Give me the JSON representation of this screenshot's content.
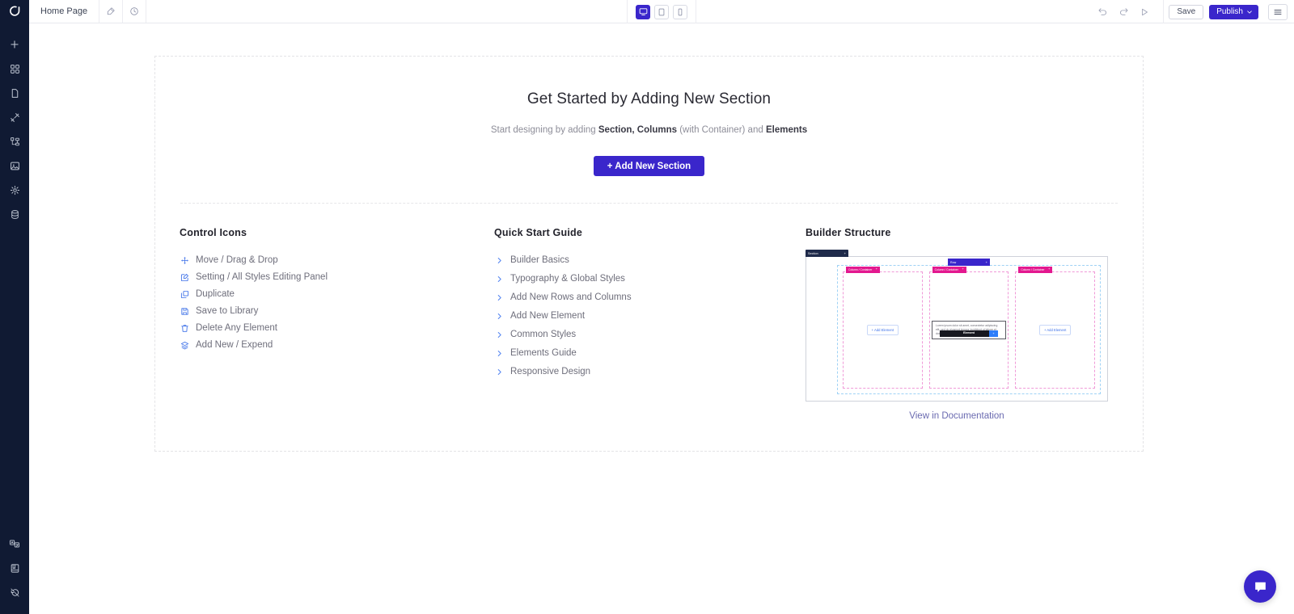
{
  "app": {
    "logo_icon": "droip-logo-icon",
    "accent": "#3A26CB",
    "rail_bg": "#101A33"
  },
  "topbar": {
    "page_name": "Home Page",
    "pen_icon": "pen-tool-icon",
    "history_icon": "clock-history-icon",
    "devices": [
      {
        "name": "desktop",
        "icon": "desktop-icon",
        "active": true
      },
      {
        "name": "tablet",
        "icon": "tablet-icon",
        "active": false
      },
      {
        "name": "mobile",
        "icon": "mobile-icon",
        "active": false
      }
    ],
    "undo_icon": "undo-icon",
    "redo_icon": "redo-icon",
    "preview_icon": "play-preview-icon",
    "save_label": "Save",
    "publish_label": "Publish",
    "publish_caret": "⌄",
    "menu_icon": "hamburger-menu-icon"
  },
  "sidebar": {
    "items": [
      {
        "name": "add",
        "icon": "plus-icon"
      },
      {
        "name": "elements",
        "icon": "grid-widgets-icon"
      },
      {
        "name": "pages",
        "icon": "page-document-icon"
      },
      {
        "name": "styles",
        "icon": "paint-brush-icon"
      },
      {
        "name": "layers",
        "icon": "layers-tree-icon"
      },
      {
        "name": "media",
        "icon": "image-icon"
      },
      {
        "name": "settings",
        "icon": "gear-icon"
      },
      {
        "name": "data",
        "icon": "database-icon"
      }
    ],
    "bottom_items": [
      {
        "name": "translate",
        "icon": "translate-icon"
      },
      {
        "name": "docs",
        "icon": "book-icon"
      },
      {
        "name": "shortcuts",
        "icon": "history-revert-icon"
      }
    ]
  },
  "onboarding": {
    "title": "Get Started by Adding New Section",
    "subtitle_parts": [
      {
        "text": "Start designing by adding ",
        "bold": false
      },
      {
        "text": "Section, Columns",
        "bold": true
      },
      {
        "text": " (with Container) and ",
        "bold": false
      },
      {
        "text": "Elements",
        "bold": true
      }
    ],
    "subtitle_plain": "Start designing by adding Section, Columns (with Container) and Elements",
    "subtitle_lead": "Start designing by adding ",
    "subtitle_bold1": "Section, Columns",
    "subtitle_mid": " (with Container) and ",
    "subtitle_bold2": "Elements",
    "add_section_label": "+ Add New Section"
  },
  "control_icons": {
    "title": "Control Icons",
    "items": [
      {
        "label": "Move / Drag & Drop",
        "icon": "move-arrows-icon"
      },
      {
        "label": "Setting / All Styles Editing Panel",
        "icon": "edit-pencil-square-icon"
      },
      {
        "label": "Duplicate",
        "icon": "duplicate-copy-icon"
      },
      {
        "label": "Save to Library",
        "icon": "save-floppy-icon"
      },
      {
        "label": "Delete Any Element",
        "icon": "trash-bin-icon"
      },
      {
        "label": "Add New / Expend",
        "icon": "stack-add-icon"
      }
    ]
  },
  "quick_start": {
    "title": "Quick Start Guide",
    "items": [
      {
        "label": "Builder Basics",
        "icon": "chevron-right-icon"
      },
      {
        "label": "Typography & Global Styles",
        "icon": "chevron-right-icon"
      },
      {
        "label": "Add New Rows and Columns",
        "icon": "chevron-right-icon"
      },
      {
        "label": "Add New Element",
        "icon": "chevron-right-icon"
      },
      {
        "label": "Common Styles",
        "icon": "chevron-right-icon"
      },
      {
        "label": "Elements Guide",
        "icon": "chevron-right-icon"
      },
      {
        "label": "Responsive Design",
        "icon": "chevron-right-icon"
      }
    ]
  },
  "builder_structure": {
    "title": "Builder Structure",
    "doc_link": "View in Documentation",
    "diagram": {
      "section_label": "Section",
      "row_label": "Row",
      "column_label": "Column / Container",
      "add_element_label": "+ Add Element",
      "element_label": "Element",
      "placeholder_text": "Lorem ipsum dolor sit amet, consectetur adipiscing elit, sed do eiusmod tempor incididunt ut labore et dolore magna aliqua veniam quis nostrud.",
      "colors": {
        "section": "#1F2A4A",
        "row": "#3A26CB",
        "column": "#E3188F",
        "element": "#17181F",
        "element_plus": "#2d7dfa"
      }
    }
  },
  "chat": {
    "icon": "chat-bubble-icon",
    "color": "#3A26CB"
  }
}
